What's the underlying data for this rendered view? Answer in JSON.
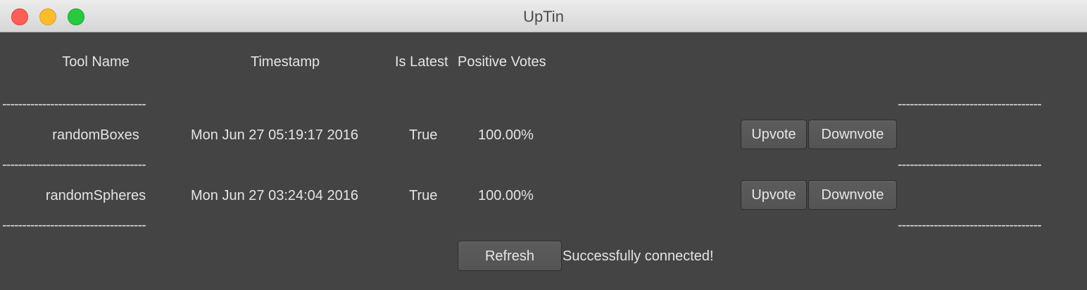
{
  "window": {
    "title": "UpTin"
  },
  "table": {
    "headers": {
      "tool_name": "Tool Name",
      "timestamp": "Timestamp",
      "is_latest": "Is Latest",
      "positive_votes": "Positive Votes"
    },
    "separator": "------------------------------------",
    "rows": [
      {
        "tool_name": "randomBoxes",
        "timestamp": "Mon Jun 27 05:19:17 2016",
        "is_latest": "True",
        "positive_votes": "100.00%",
        "upvote_label": "Upvote",
        "downvote_label": "Downvote"
      },
      {
        "tool_name": "randomSpheres",
        "timestamp": "Mon Jun 27 03:24:04 2016",
        "is_latest": "True",
        "positive_votes": "100.00%",
        "upvote_label": "Upvote",
        "downvote_label": "Downvote"
      }
    ]
  },
  "footer": {
    "refresh_label": "Refresh",
    "status": "Successfully connected!"
  }
}
